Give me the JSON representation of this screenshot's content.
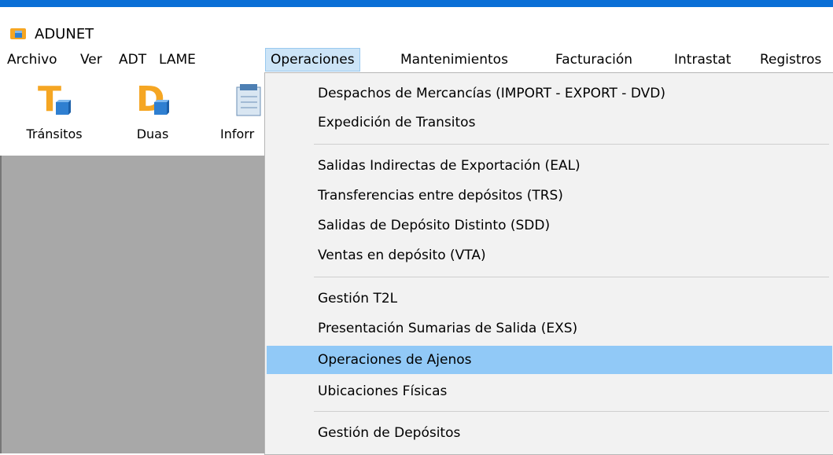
{
  "window": {
    "title": "ADUNET",
    "app_icon": "adunet-cube-icon"
  },
  "menubar": {
    "items": [
      "Archivo",
      "Ver",
      "ADT",
      "LAME",
      "Operaciones",
      "Mantenimientos",
      "Facturación",
      "Intrastat",
      "Registros"
    ],
    "active": "Operaciones"
  },
  "toolbar": {
    "items": [
      {
        "label": "Tránsitos",
        "icon": "transitos-icon"
      },
      {
        "label": "Duas",
        "icon": "duas-icon"
      },
      {
        "label": "Inforr",
        "icon": "informes-icon"
      }
    ]
  },
  "dropdown": {
    "items": [
      "Despachos de Mercancías (IMPORT - EXPORT -  DVD)",
      "Expedición de Transitos",
      "Salidas Indirectas de Exportación (EAL)",
      "Transferencias entre depósitos (TRS)",
      "Salidas de Depósito Distinto (SDD)",
      "Ventas en depósito (VTA)",
      "Gestión T2L",
      "Presentación Sumarias de Salida (EXS)",
      "Operaciones de Ajenos",
      "Ubicaciones Físicas",
      "Gestión de Depósitos"
    ],
    "highlighted": "Operaciones de Ajenos"
  },
  "colors": {
    "title_accent": "#0a6fd6",
    "menu_active_bg": "#cce4f7",
    "dropdown_highlight": "#91c9f7",
    "workspace_bg": "#a8a8a8",
    "icon_orange": "#f5a623"
  }
}
